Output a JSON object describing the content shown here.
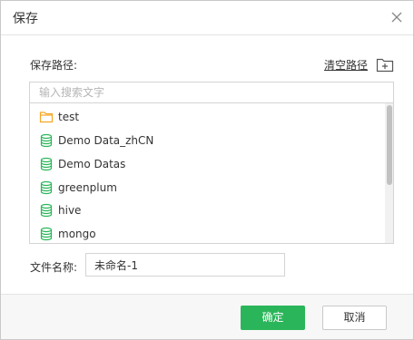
{
  "dialog": {
    "title": "保存",
    "close_icon": "close-icon"
  },
  "path": {
    "label": "保存路径:",
    "clear_label": "清空路径",
    "new_folder_icon": "new-folder-icon"
  },
  "search": {
    "placeholder": "输入搜索文字",
    "value": ""
  },
  "tree": {
    "items": [
      {
        "label": "test",
        "icon": "folder-icon"
      },
      {
        "label": "Demo Data_zhCN",
        "icon": "database-icon"
      },
      {
        "label": "Demo Datas",
        "icon": "database-icon"
      },
      {
        "label": "greenplum",
        "icon": "database-icon"
      },
      {
        "label": "hive",
        "icon": "database-icon"
      },
      {
        "label": "mongo",
        "icon": "database-icon"
      }
    ]
  },
  "filename": {
    "label": "文件名称:",
    "value": "未命名-1"
  },
  "footer": {
    "ok_label": "确定",
    "cancel_label": "取消"
  },
  "colors": {
    "accent_green": "#2bb55a",
    "folder_orange": "#f5a623",
    "database_green": "#2bb55a"
  }
}
